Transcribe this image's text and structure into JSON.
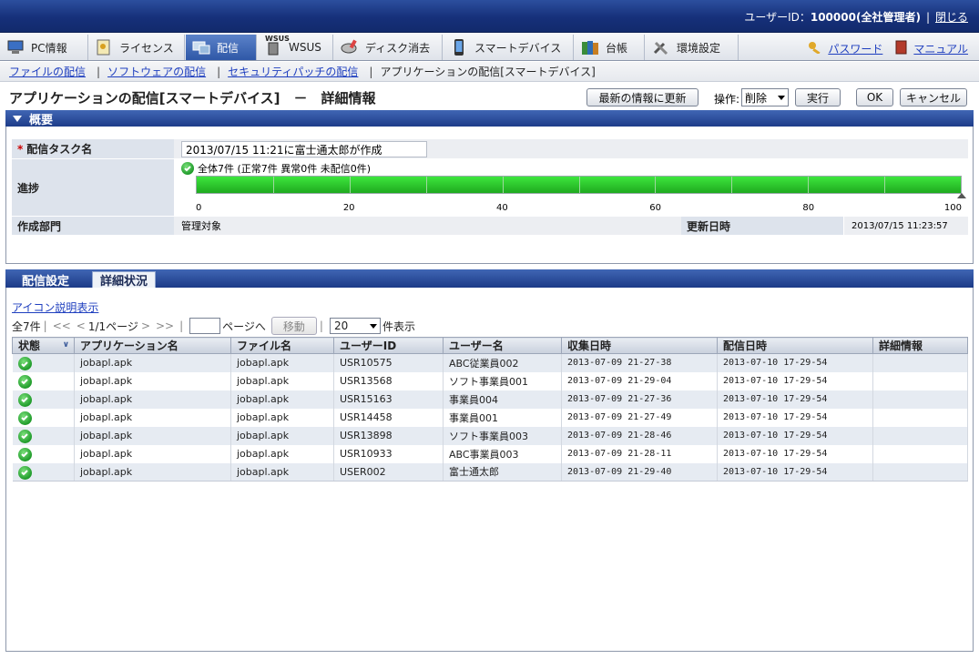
{
  "header": {
    "user_label": "ユーザーID：",
    "user_value": "100000(全社管理者)",
    "close": "閉じる"
  },
  "nav": {
    "tabs": [
      {
        "label": "PC情報",
        "icon": "pc-info-icon"
      },
      {
        "label": "ライセンス",
        "icon": "license-icon"
      },
      {
        "label": "配信",
        "icon": "distribution-icon",
        "active": true
      },
      {
        "label": "WSUS",
        "icon": "wsus-icon",
        "badge": "WSUS"
      },
      {
        "label": "ディスク消去",
        "icon": "disk-erase-icon"
      },
      {
        "label": "スマートデバイス",
        "icon": "smart-device-icon"
      },
      {
        "label": "台帳",
        "icon": "ledger-icon"
      },
      {
        "label": "環境設定",
        "icon": "settings-icon"
      }
    ],
    "password": "パスワード",
    "manual": "マニュアル"
  },
  "subnav": {
    "links": [
      "ファイルの配信",
      "ソフトウェアの配信",
      "セキュリティパッチの配信"
    ],
    "current": "アプリケーションの配信[スマートデバイス]"
  },
  "page": {
    "title": "アプリケーションの配信[スマートデバイス]　－　詳細情報",
    "refresh": "最新の情報に更新",
    "op_label": "操作:",
    "op_value": "削除",
    "execute": "実行",
    "ok": "OK",
    "cancel": "キャンセル"
  },
  "overview": {
    "header": "概要",
    "task_label": "配信タスク名",
    "task_value": "2013/07/15 11:21に富士通太郎が作成",
    "progress_label": "進捗",
    "progress_summary": "全体7件 (正常7件 異常0件 未配信0件)",
    "progress_ticks": [
      "0",
      "20",
      "40",
      "60",
      "80",
      "100"
    ],
    "progress_percent": 100,
    "dept_label": "作成部門",
    "dept_value": "管理対象",
    "updated_label": "更新日時",
    "updated_value": "2013/07/15 11:23:57"
  },
  "tabs": {
    "settings": "配信設定",
    "detail": "詳細状況"
  },
  "detail": {
    "icon_legend": "アイコン説明表示",
    "total": "全7件",
    "first": "<<",
    "prev": "<",
    "page": "1/1ページ",
    "next": ">",
    "last": ">>",
    "goto_suffix": "ページへ",
    "move": "移動",
    "per_page": "20",
    "per_page_suffix": "件表示",
    "columns": [
      "状態",
      "アプリケーション名",
      "ファイル名",
      "ユーザーID",
      "ユーザー名",
      "収集日時",
      "配信日時",
      "詳細情報"
    ],
    "rows": [
      {
        "status": "ok",
        "app": "jobapl.apk",
        "file": "jobapl.apk",
        "uid": "USR10575",
        "uname": "ABC従業員002",
        "collected": "2013-07-09 21-27-38",
        "delivered": "2013-07-10 17-29-54",
        "info": ""
      },
      {
        "status": "ok",
        "app": "jobapl.apk",
        "file": "jobapl.apk",
        "uid": "USR13568",
        "uname": "ソフト事業員001",
        "collected": "2013-07-09 21-29-04",
        "delivered": "2013-07-10 17-29-54",
        "info": ""
      },
      {
        "status": "ok",
        "app": "jobapl.apk",
        "file": "jobapl.apk",
        "uid": "USR15163",
        "uname": "事業員004",
        "collected": "2013-07-09 21-27-36",
        "delivered": "2013-07-10 17-29-54",
        "info": ""
      },
      {
        "status": "ok",
        "app": "jobapl.apk",
        "file": "jobapl.apk",
        "uid": "USR14458",
        "uname": "事業員001",
        "collected": "2013-07-09 21-27-49",
        "delivered": "2013-07-10 17-29-54",
        "info": ""
      },
      {
        "status": "ok",
        "app": "jobapl.apk",
        "file": "jobapl.apk",
        "uid": "USR13898",
        "uname": "ソフト事業員003",
        "collected": "2013-07-09 21-28-46",
        "delivered": "2013-07-10 17-29-54",
        "info": ""
      },
      {
        "status": "ok",
        "app": "jobapl.apk",
        "file": "jobapl.apk",
        "uid": "USR10933",
        "uname": "ABC事業員003",
        "collected": "2013-07-09 21-28-11",
        "delivered": "2013-07-10 17-29-54",
        "info": ""
      },
      {
        "status": "ok",
        "app": "jobapl.apk",
        "file": "jobapl.apk",
        "uid": "USER002",
        "uname": "富士通太郎",
        "collected": "2013-07-09 21-29-40",
        "delivered": "2013-07-10 17-29-54",
        "info": ""
      }
    ]
  },
  "colors": {
    "header_blue": "#16307a",
    "active_tab": "#2f58a7",
    "progress_green": "#29c429",
    "link": "#1f3fbf"
  }
}
